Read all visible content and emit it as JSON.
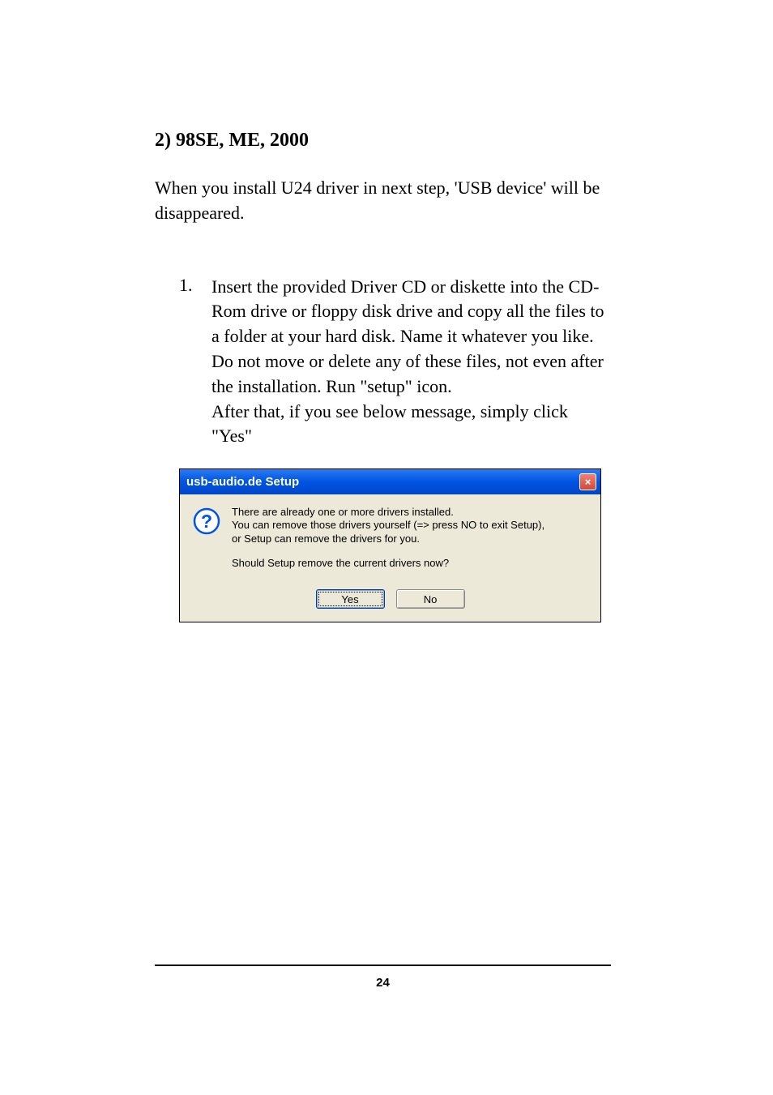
{
  "heading": "2) 98SE, ME, 2000",
  "intro": "When you install U24 driver in next step, 'USB device' will be disappeared.",
  "list": {
    "number": "1.",
    "para1": "Insert the provided Driver CD or diskette into the CD-Rom drive or floppy disk drive and copy all the files to a folder at your hard disk. Name it whatever you like. Do not move or delete any of these files, not even after the installation. Run \"setup\" icon.",
    "para2": "After that, if you see below message, simply click \"Yes\""
  },
  "dialog": {
    "title": "usb-audio.de Setup",
    "close": "×",
    "line1": "There are already one or more drivers installed.",
    "line2": "You can remove those drivers yourself (=> press NO to exit Setup),",
    "line3": "or Setup can remove the drivers for you.",
    "line4": "Should Setup remove the current drivers now?",
    "yes": "Yes",
    "no": "No"
  },
  "page_number": "24"
}
